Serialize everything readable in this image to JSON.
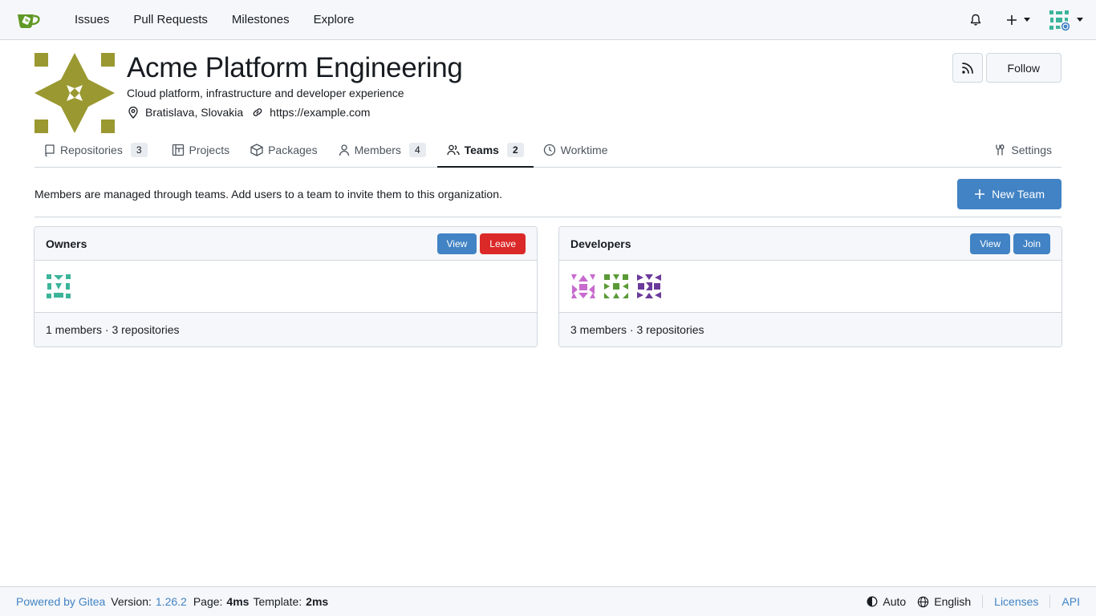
{
  "nav": {
    "items": [
      "Issues",
      "Pull Requests",
      "Milestones",
      "Explore"
    ]
  },
  "org": {
    "name": "Acme Platform Engineering",
    "description": "Cloud platform, infrastructure and developer experience",
    "location": "Bratislava, Slovakia",
    "website": "https://example.com",
    "follow_label": "Follow",
    "avatar_color": "#9a9830"
  },
  "tabs": [
    {
      "label": "Repositories",
      "count": "3",
      "icon": "repo-icon"
    },
    {
      "label": "Projects",
      "count": "",
      "icon": "project-icon"
    },
    {
      "label": "Packages",
      "count": "",
      "icon": "package-icon"
    },
    {
      "label": "Members",
      "count": "4",
      "icon": "person-icon"
    },
    {
      "label": "Teams",
      "count": "2",
      "icon": "people-icon",
      "active": true
    },
    {
      "label": "Worktime",
      "count": "",
      "icon": "clock-icon"
    },
    {
      "label": "Settings",
      "count": "",
      "icon": "tools-icon"
    }
  ],
  "teams_info": "Members are managed through teams. Add users to a team to invite them to this organization.",
  "new_team_label": "New Team",
  "teams": [
    {
      "name": "Owners",
      "view_label": "View",
      "action_label": "Leave",
      "summary": "1 members · 3 repositories"
    },
    {
      "name": "Developers",
      "view_label": "View",
      "action_label": "Join",
      "summary": "3 members · 3 repositories"
    }
  ],
  "footer": {
    "powered": "Powered by Gitea",
    "version_label": "Version:",
    "version": "1.26.2",
    "page_label": "Page:",
    "page_time": "4ms",
    "template_label": "Template:",
    "template_time": "2ms",
    "theme": "Auto",
    "language": "English",
    "licenses": "Licenses",
    "api": "API"
  },
  "colors": {
    "accent": "#4183c4",
    "danger": "#db2828",
    "gitea_green": "#609926"
  }
}
